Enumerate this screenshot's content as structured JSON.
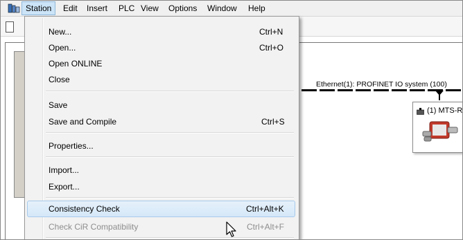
{
  "menubar": {
    "items": [
      "Station",
      "Edit",
      "Insert",
      "PLC",
      "View",
      "Options",
      "Window",
      "Help"
    ],
    "active": "Station"
  },
  "workspace": {
    "network_label": "Ethernet(1): PROFINET IO system (100)",
    "device_label": "(1) MTS-R"
  },
  "station_menu": {
    "items": [
      {
        "label": "New...",
        "shortcut": "Ctrl+N"
      },
      {
        "label": "Open...",
        "shortcut": "Ctrl+O"
      },
      {
        "label": "Open ONLINE",
        "shortcut": ""
      },
      {
        "label": "Close",
        "shortcut": ""
      },
      {
        "label": "Save",
        "shortcut": ""
      },
      {
        "label": "Save and Compile",
        "shortcut": "Ctrl+S"
      },
      {
        "label": "Properties...",
        "shortcut": ""
      },
      {
        "label": "Import...",
        "shortcut": ""
      },
      {
        "label": "Export...",
        "shortcut": ""
      },
      {
        "label": "Consistency Check",
        "shortcut": "Ctrl+Alt+K"
      },
      {
        "label": "Check CiR Compatibility",
        "shortcut": "Ctrl+Alt+F"
      }
    ],
    "highlighted": "Consistency Check",
    "disabled": [
      "Check CiR Compatibility"
    ]
  },
  "colors": {
    "menu_highlight": "#d5e8f8",
    "menu_bg": "#f2f2f2",
    "disabled_text": "#8d8d8d"
  }
}
